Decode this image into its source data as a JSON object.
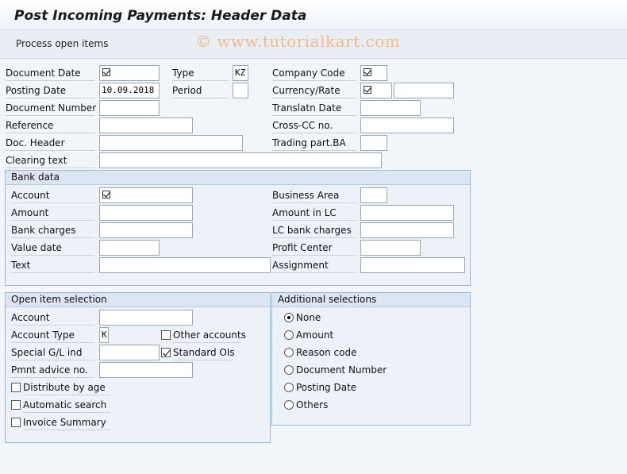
{
  "title": "Post Incoming Payments: Header Data",
  "toolbar": {
    "process_open_items": "Process open items"
  },
  "watermark": "© www.tutorialkart.com",
  "header": {
    "document_date_label": "Document Date",
    "type_label": "Type",
    "type_value": "KZ",
    "company_code_label": "Company Code",
    "posting_date_label": "Posting Date",
    "posting_date_value": "10.09.2018",
    "period_label": "Period",
    "currency_rate_label": "Currency/Rate",
    "document_number_label": "Document Number",
    "translatn_date_label": "Translatn Date",
    "reference_label": "Reference",
    "cross_cc_label": "Cross-CC no.",
    "doc_header_label": "Doc. Header",
    "trading_part_label": "Trading part.BA",
    "clearing_text_label": "Clearing text"
  },
  "bank_data": {
    "title": "Bank data",
    "account_label": "Account",
    "business_area_label": "Business Area",
    "amount_label": "Amount",
    "amount_lc_label": "Amount in LC",
    "bank_charges_label": "Bank charges",
    "lc_bank_charges_label": "LC bank charges",
    "value_date_label": "Value date",
    "profit_center_label": "Profit Center",
    "text_label": "Text",
    "assignment_label": "Assignment"
  },
  "open_item_selection": {
    "title": "Open item selection",
    "account_label": "Account",
    "account_type_label": "Account Type",
    "account_type_value": "K",
    "other_accounts_label": "Other accounts",
    "special_gl_label": "Special G/L ind",
    "standard_ois_label": "Standard OIs",
    "pmnt_advice_label": "Pmnt advice no.",
    "distribute_by_age_label": "Distribute by age",
    "automatic_search_label": "Automatic search",
    "invoice_summary_label": "Invoice Summary"
  },
  "additional_selections": {
    "title": "Additional selections",
    "options": [
      "None",
      "Amount",
      "Reason code",
      "Document Number",
      "Posting Date",
      "Others"
    ],
    "selected": "None"
  }
}
